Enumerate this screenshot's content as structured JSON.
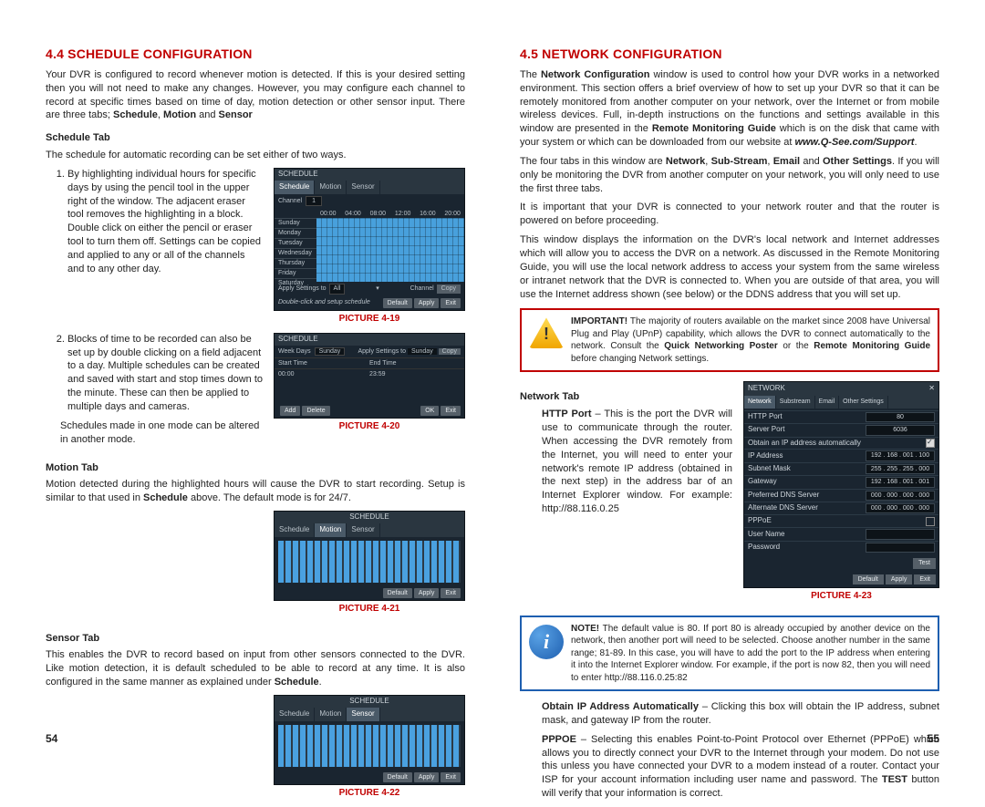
{
  "left": {
    "heading": "4.4 SCHEDULE CONFIGURATION",
    "intro": "Your DVR is configured to record whenever motion is detected. If this is your desired setting then you will not need to make any changes. However, you may configure each channel to record at specific times based on time of day, motion detection or other sensor input. There are three tabs; ",
    "intro_bold1": "Schedule",
    "intro_mid1": ", ",
    "intro_bold2": "Motion",
    "intro_mid2": " and ",
    "intro_bold3": "Sensor",
    "scheduleTab": "Schedule Tab",
    "scheduleIntro": "The schedule for automatic recording can be set either of two ways.",
    "item1": "By highlighting individual hours for specific days by using the pencil tool in the upper right of the window. The adjacent eraser tool removes the highlighting in a block. Double click on either the pencil or eraser tool to turn them off. Settings can be copied and applied to any or all of the channels and to any other day.",
    "item2": "Blocks of time to be recorded can also be set up by double clicking on a field adjacent to a day. Multiple schedules can be created and saved with start and stop times down to the minute. These can then be applied to multiple days and cameras.",
    "schedNote": "Schedules made in one mode can be altered in another mode.",
    "cap19": "PICTURE 4-19",
    "cap20": "PICTURE 4-20",
    "motionTab": "Motion Tab",
    "motionPara_a": "Motion detected during the highlighted hours will cause the DVR to start recording. Setup is similar to that used in ",
    "motionPara_b": "Schedule",
    "motionPara_c": " above. The default mode is for 24/7.",
    "cap21": "PICTURE 4-21",
    "sensorTab": "Sensor Tab",
    "sensorPara_a": "This enables the DVR to record based on input from other sensors connected to the DVR. Like motion detection, it is default scheduled to be able to record at any time. It is also configured in the same manner as explained under ",
    "sensorPara_b": "Schedule",
    "sensorPara_c": ".",
    "cap22": "PICTURE 4-22",
    "pageNum": "54",
    "ss": {
      "scheduleTitle": "SCHEDULE",
      "tabSchedule": "Schedule",
      "tabMotion": "Motion",
      "tabSensor": "Sensor",
      "channelLabel": "Channel",
      "ch1": "1",
      "t0": "00:00",
      "t1": "04:00",
      "t2": "08:00",
      "t3": "12:00",
      "t4": "16:00",
      "t5": "20:00",
      "dSun": "Sunday",
      "dMon": "Monday",
      "dTue": "Tuesday",
      "dWed": "Wednesday",
      "dThu": "Thursday",
      "dFri": "Friday",
      "dSat": "Saturday",
      "applyTo": "Apply Settings to",
      "all": "All",
      "channel": "Channel",
      "copy": "Copy",
      "hint": "Double-click  and  setup  schedule",
      "default": "Default",
      "apply": "Apply",
      "exit": "Exit",
      "weekDays": "Week Days",
      "sunday": "Sunday",
      "startTime": "Start Time",
      "endTime": "End Time",
      "add": "Add",
      "delete": "Delete",
      "ok": "OK"
    }
  },
  "right": {
    "heading": "4.5 NETWORK CONFIGURATION",
    "p1a": "The ",
    "p1b": "Network Configuration",
    "p1c": " window is used to control how your DVR works in a networked environment. This section offers a brief overview of how to set up your DVR so that it can be remotely monitored from another computer on your network, over the Internet or from mobile wireless devices. Full, in-depth instructions on the functions and settings available in this window are presented in the ",
    "p1d": "Remote Monitoring Guide",
    "p1e": " which is on the disk that came with your system or which can be downloaded from our website at ",
    "p1f": "www.Q-See.com/Support",
    "p1g": ".",
    "p2a": "The four tabs in this window are ",
    "p2b": "Network",
    "p2c": ", ",
    "p2d": "Sub-Stream",
    "p2e": ", ",
    "p2f": "Email",
    "p2g": " and ",
    "p2h": "Other Settings",
    "p2i": ". If you will only be monitoring the DVR from another computer on your network, you will only need to use the first three tabs.",
    "p3": "It is important that your DVR is connected to your network router and that the router is powered on before proceeding.",
    "p4": "This window displays the information on the DVR's local network and Internet addresses which will allow you to access the DVR on a network. As discussed in the Remote Monitoring Guide, you will use the local network address to access your system from the same wireless or intranet network that the DVR is connected to. When you are outside of that area, you will use the Internet address shown (see below) or the DDNS address that you will set up.",
    "warn": {
      "lead": "IMPORTANT!",
      "body_a": " The majority of routers available on the market since 2008 have Universal Plug and Play (UPnP) capability, which allows the DVR to connect automatically to the network. Consult the ",
      "body_b": "Quick Networking Poster",
      "body_c": " or the ",
      "body_d": "Remote Monitoring Guide",
      "body_e": " before changing Network settings."
    },
    "networkTab": "Network Tab",
    "httpTerm": "HTTP Port",
    "httpBody": " – This is the port the DVR will use to communicate through the router. When accessing the DVR remotely from the Internet, you will need to enter your network's remote IP address (obtained in the next step) in the address bar of an Internet Explorer window. For example: http://88.116.0.25",
    "cap23": "PICTURE 4-23",
    "note": {
      "lead": "NOTE!",
      "body": " The default value is 80. If port 80 is already occupied by another device on the network, then another port will need to be selected. Choose another number in the same range; 81-89. In this case, you will have to add the port to the IP address when entering it into the Internet Explorer window. For example, if the port is now 82, then you will need to enter http://88.116.0.25:82"
    },
    "obtainTerm": "Obtain IP Address Automatically",
    "obtainBody": " – Clicking this box will obtain the IP address, subnet mask, and gateway IP from the router.",
    "pppoeTerm": "PPPOE",
    "pppoeBody_a": " – Selecting this enables Point-to-Point Protocol over Ethernet (PPPoE) which allows you to directly connect your DVR to the Internet through your modem. Do not use this unless you have connected your DVR to a modem instead of a router. Contact your ISP for your account information including user name and password. The ",
    "pppoeBody_b": "TEST",
    "pppoeBody_c": " button will verify that your information is correct.",
    "pageNum": "55",
    "np": {
      "title": "NETWORK",
      "tabNetwork": "Network",
      "tabSub": "Substream",
      "tabEmail": "Email",
      "tabOther": "Other Settings",
      "httpPort": "HTTP Port",
      "httpVal": "80",
      "serverPort": "Server Port",
      "serverVal": "6036",
      "obtain": "Obtain an IP address automatically",
      "ipAddr": "IP Address",
      "ipVal": "192 . 168 . 001 . 100",
      "subnet": "Subnet Mask",
      "subnetVal": "255 . 255 . 255 . 000",
      "gateway": "Gateway",
      "gatewayVal": "192 . 168 . 001 . 001",
      "pdns": "Preferred DNS Server",
      "pdnsVal": "000 . 000 . 000 . 000",
      "adns": "Alternate DNS Server",
      "adnsVal": "000 . 000 . 000 . 000",
      "pppoe": "PPPoE",
      "user": "User Name",
      "pass": "Password",
      "test": "Test",
      "default": "Default",
      "apply": "Apply",
      "exit": "Exit"
    }
  }
}
